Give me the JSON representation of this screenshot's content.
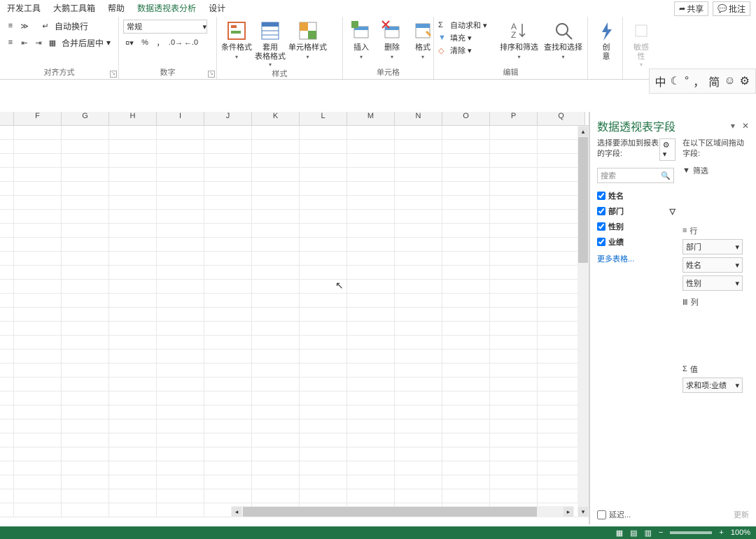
{
  "menu": {
    "items": [
      "开发工具",
      "大鹅工具箱",
      "帮助",
      "数据透视表分析",
      "设计"
    ],
    "activeIndex": 3,
    "share": "共享",
    "comment": "批注"
  },
  "ribbon": {
    "align": {
      "wrap": "自动换行",
      "merge": "合并后居中",
      "label": "对齐方式"
    },
    "number": {
      "format": "常规",
      "label": "数字"
    },
    "styles": {
      "cond": "条件格式",
      "table": "套用\n表格格式",
      "cell": "单元格样式",
      "label": "样式"
    },
    "cells": {
      "insert": "插入",
      "delete": "删除",
      "format": "格式",
      "label": "单元格"
    },
    "edit": {
      "autosum": "自动求和",
      "fill": "填充",
      "clear": "清除",
      "sortfilter": "排序和筛选",
      "findselect": "查找和选择",
      "label": "编辑"
    },
    "idea": {
      "label": "创\n意"
    },
    "sensitivity": {
      "label": "敏感\n性"
    }
  },
  "columns": [
    "F",
    "G",
    "H",
    "I",
    "J",
    "K",
    "L",
    "M",
    "N",
    "O",
    "P",
    "Q"
  ],
  "panel": {
    "title": "数据透视表字段",
    "desc": "选择要添加到报表的字段:",
    "search": "搜索",
    "fields": [
      {
        "label": "姓名",
        "checked": true,
        "bold": true
      },
      {
        "label": "部门",
        "checked": true,
        "bold": true,
        "filter": true
      },
      {
        "label": "性别",
        "checked": true,
        "bold": true
      },
      {
        "label": "业绩",
        "checked": true,
        "bold": true
      }
    ],
    "more": "更多表格...",
    "rdesc": "在以下区域间拖动字段:",
    "filter_lbl": "筛选",
    "rows_lbl": "行",
    "rows": [
      "部门",
      "姓名",
      "性别"
    ],
    "cols_lbl": "列",
    "vals_lbl": "值",
    "vals": [
      "求和项:业绩"
    ],
    "defer": "延迟...",
    "update": "更新"
  },
  "status": {
    "zoom": "100%"
  },
  "ime": [
    "中",
    "☾",
    "°",
    "，",
    "简",
    "☺",
    "⚙"
  ]
}
